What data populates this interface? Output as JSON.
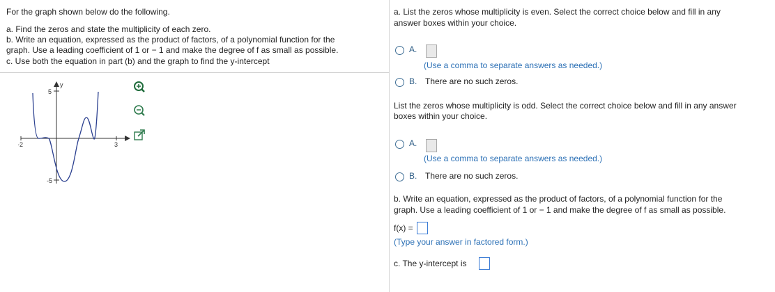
{
  "left_panel": {
    "intro": "For the graph shown below do the following.",
    "item_a": "a. Find the zeros and state the multiplicity of each zero.",
    "item_b_line1": "b. Write an equation, expressed as the product of factors, of a polynomial function for the",
    "item_b_line2": "graph. Use a leading coefficient of 1 or − 1 and make the degree of f as small as possible.",
    "item_c": "c. Use both the equation in part (b) and the graph to find the y-intercept",
    "graph": {
      "y_axis_label": "y",
      "tick_y_top": "5",
      "tick_y_bottom": "-5",
      "tick_x_left": "-2",
      "tick_x_right": "3"
    },
    "tools": {
      "zoom_in_icon": "zoom-in-icon",
      "zoom_out_icon": "zoom-out-icon",
      "popout_icon": "external-link-icon"
    }
  },
  "right_panel": {
    "part_a": {
      "even_prompt_line1": "a. List the zeros whose multiplicity is even. Select the correct choice below and fill in any",
      "even_prompt_line2": "answer boxes within your choice.",
      "even_option_a_letter": "A.",
      "even_option_a_hint": "(Use a comma to separate answers as needed.)",
      "even_option_b_letter": "B.",
      "even_option_b_text": "There are no such zeros.",
      "odd_prompt_line1": "List the zeros whose multiplicity is odd. Select the correct choice below and fill in any answer",
      "odd_prompt_line2": "boxes within your choice.",
      "odd_option_a_letter": "A.",
      "odd_option_a_hint": "(Use a comma to separate answers as needed.)",
      "odd_option_b_letter": "B.",
      "odd_option_b_text": "There are no such zeros."
    },
    "part_b": {
      "prompt_line1": "b. Write an equation, expressed as the product of factors, of a polynomial function for the",
      "prompt_line2": "graph. Use a leading coefficient of 1 or − 1 and make the degree of f as small as possible.",
      "fx_label": "f(x) =",
      "hint": "(Type your answer in factored form.)"
    },
    "part_c": {
      "label": "c.  The y-intercept is"
    }
  },
  "colors": {
    "accent_blue": "#2a6fb5",
    "radio_border": "#3f6f96",
    "curve": "#2a3f8f"
  }
}
